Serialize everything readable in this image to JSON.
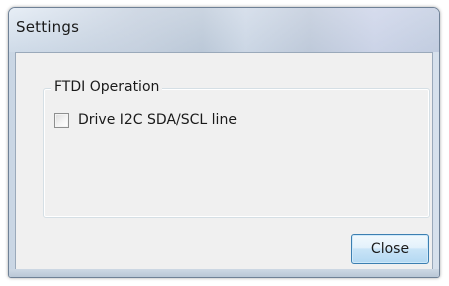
{
  "window": {
    "title": "Settings"
  },
  "group": {
    "legend": "FTDI Operation",
    "checkbox": {
      "label": "Drive I2C SDA/SCL line",
      "checked": false
    }
  },
  "buttons": {
    "close_label": "Close"
  },
  "colors": {
    "button_border": "#3c7fb1",
    "client_background": "#f0f0f0",
    "frame_border": "#6f8196"
  }
}
